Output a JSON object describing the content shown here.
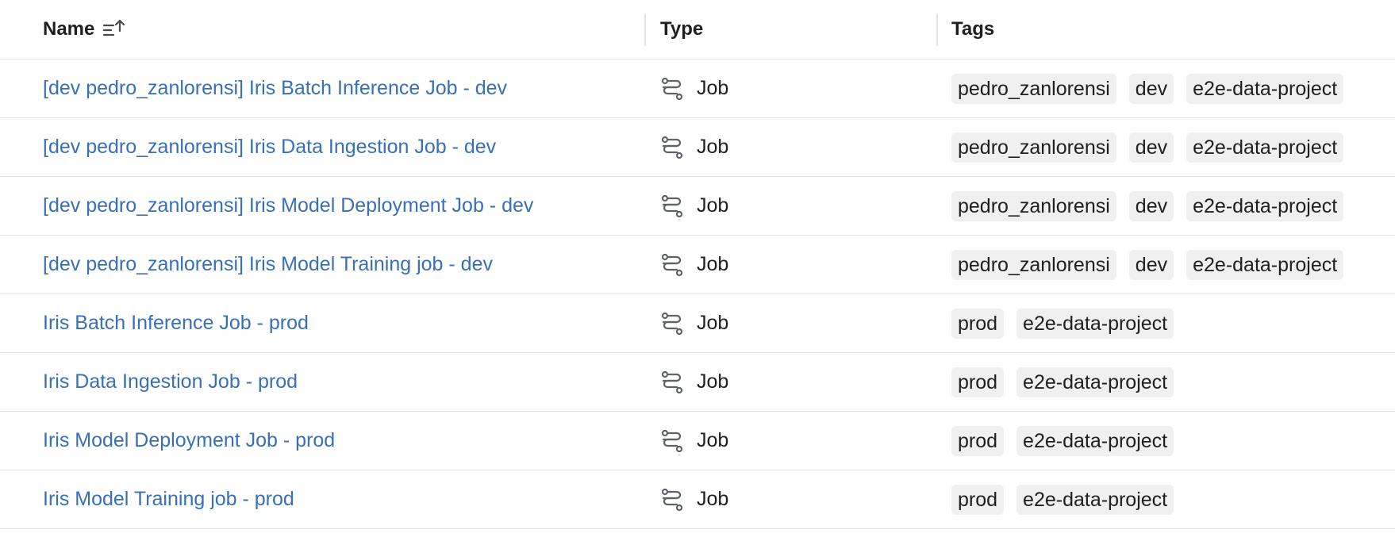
{
  "columns": {
    "name": "Name",
    "type": "Type",
    "tags": "Tags"
  },
  "sort_icon": "sort-ascending-icon",
  "type_icon": "job-workflow-icon",
  "colors": {
    "link": "#3a6fb5",
    "tag_bg": "#f0f0f0",
    "border": "#e6e6e6"
  },
  "rows": [
    {
      "name": "[dev pedro_zanlorensi] Iris Batch Inference Job - dev",
      "type": "Job",
      "tags": [
        "pedro_zanlorensi",
        "dev",
        "e2e-data-project"
      ]
    },
    {
      "name": "[dev pedro_zanlorensi] Iris Data Ingestion Job - dev",
      "type": "Job",
      "tags": [
        "pedro_zanlorensi",
        "dev",
        "e2e-data-project"
      ]
    },
    {
      "name": "[dev pedro_zanlorensi] Iris Model Deployment Job - dev",
      "type": "Job",
      "tags": [
        "pedro_zanlorensi",
        "dev",
        "e2e-data-project"
      ]
    },
    {
      "name": "[dev pedro_zanlorensi] Iris Model Training job - dev",
      "type": "Job",
      "tags": [
        "pedro_zanlorensi",
        "dev",
        "e2e-data-project"
      ]
    },
    {
      "name": "Iris Batch Inference Job - prod",
      "type": "Job",
      "tags": [
        "prod",
        "e2e-data-project"
      ]
    },
    {
      "name": "Iris Data Ingestion Job - prod",
      "type": "Job",
      "tags": [
        "prod",
        "e2e-data-project"
      ]
    },
    {
      "name": "Iris Model Deployment Job - prod",
      "type": "Job",
      "tags": [
        "prod",
        "e2e-data-project"
      ]
    },
    {
      "name": "Iris Model Training job - prod",
      "type": "Job",
      "tags": [
        "prod",
        "e2e-data-project"
      ]
    }
  ]
}
